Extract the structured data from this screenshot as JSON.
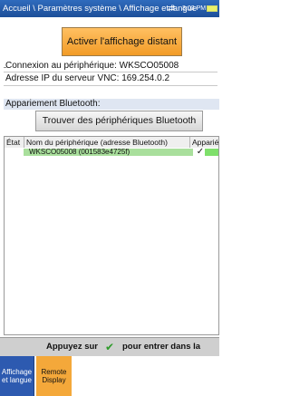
{
  "header": {
    "breadcrumb": "Accueil \\ Paramètres système \\ Affichage et langue",
    "sync_icon": "⇄",
    "time": "3:03 PM"
  },
  "remote": {
    "button_label": "Activer l'affichage distant",
    "connection": "Connexion au périphérique: WKSCO05008",
    "vnc_ip": "Adresse IP du serveur VNC: 169.254.0.2"
  },
  "bluetooth": {
    "section_title": "Appariement Bluetooth:",
    "find_button": "Trouver des périphériques Bluetooth",
    "columns": {
      "state": "État",
      "name": "Nom du périphérique (adresse Bluetooth)",
      "paired": "Apparié"
    },
    "rows": [
      {
        "state": "",
        "name": "WKSCO05008 (001583e4725f)",
        "paired": "✓"
      }
    ]
  },
  "hint": {
    "left": "Appuyez sur",
    "right": "pour entrer dans la liste"
  },
  "tabs": {
    "display_language": "Affichage et langue",
    "remote_display": "Remote Display"
  },
  "colors": {
    "header": "#1d4f99",
    "accent_orange": "#f29b26",
    "active_tab": "#2d5ab0",
    "selected_row": "#a9df9c"
  },
  "icons": {
    "sync": "sync-icon",
    "battery": "battery-icon",
    "check": "checkmark-icon"
  }
}
